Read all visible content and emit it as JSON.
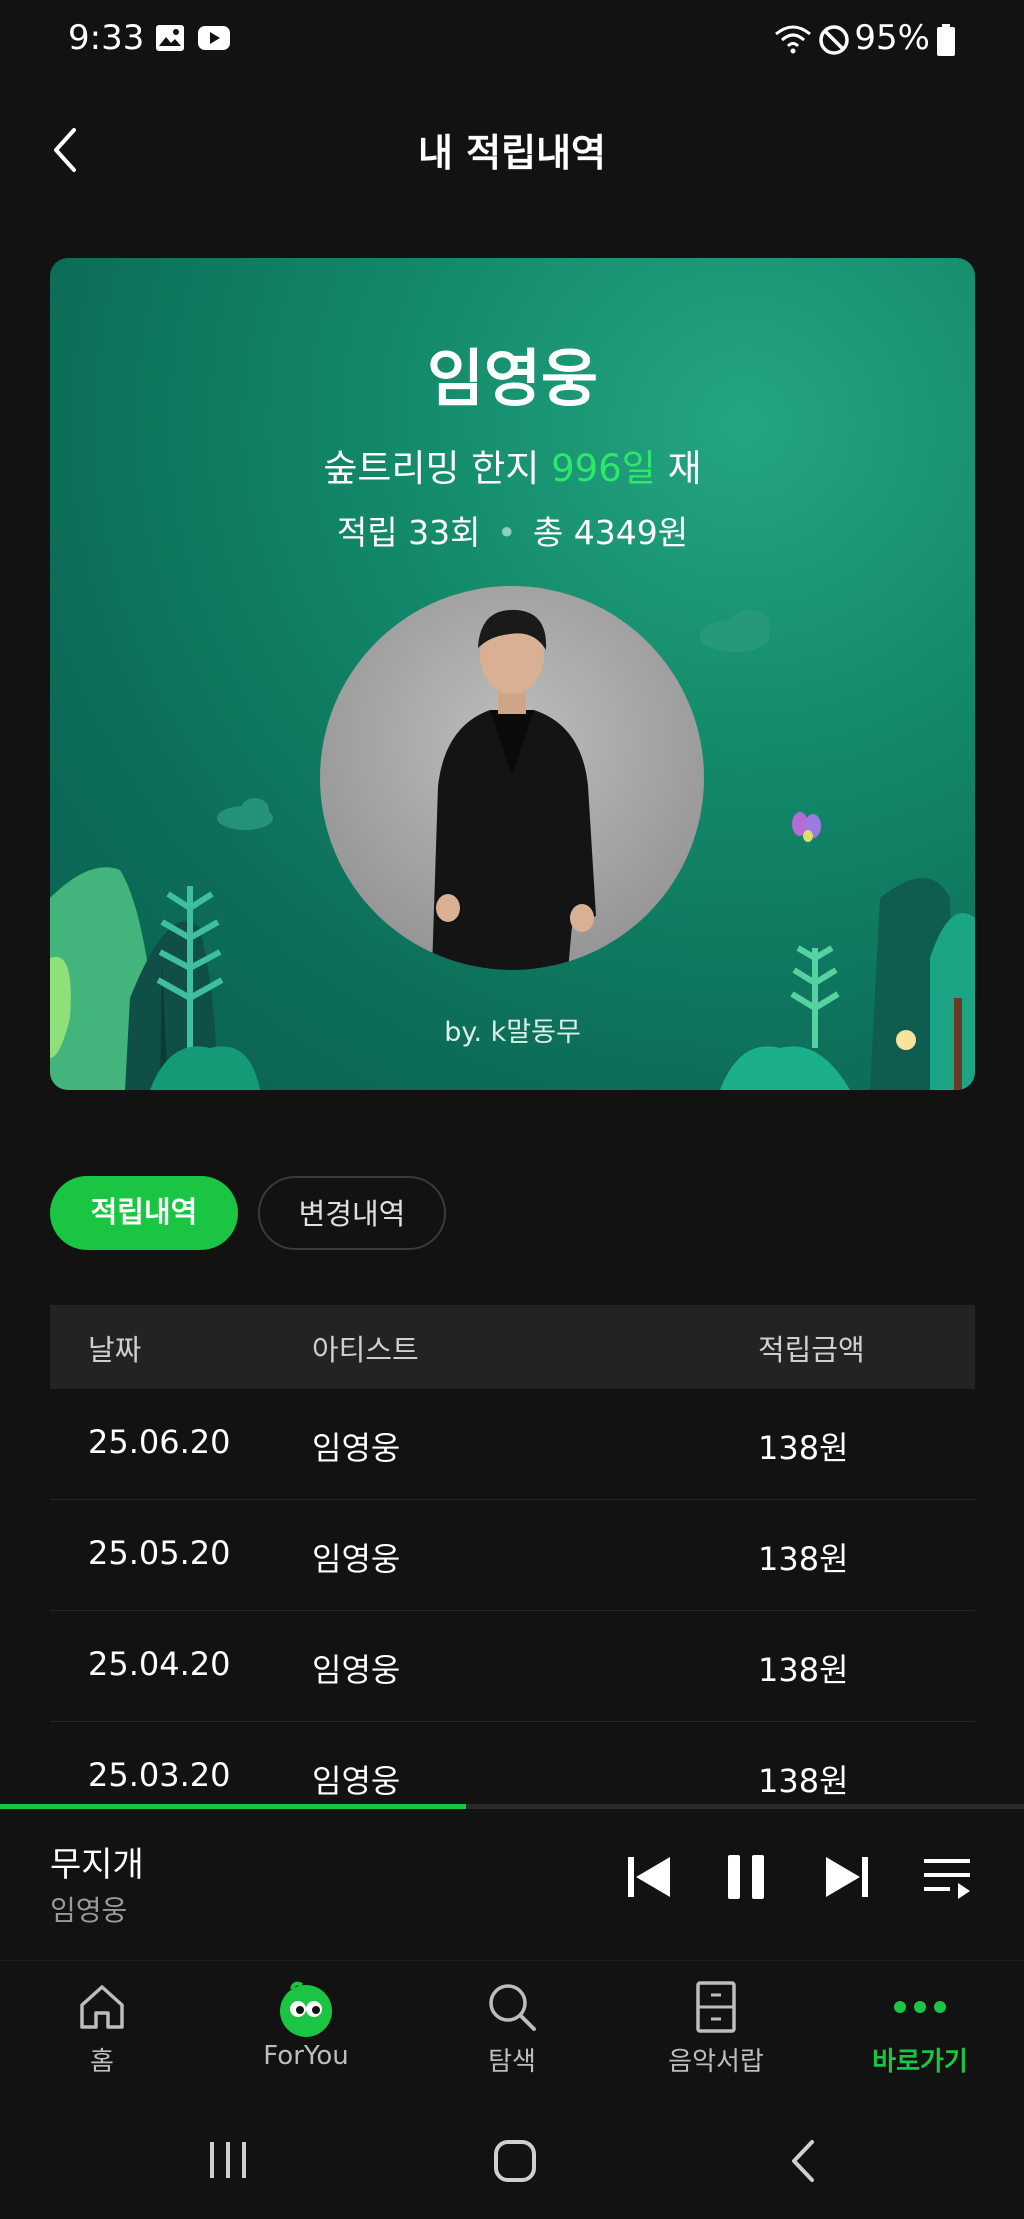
{
  "status_bar": {
    "time": "9:33",
    "battery": "95%"
  },
  "header": {
    "title": "내 적립내역"
  },
  "card": {
    "artist": "임영웅",
    "streak_prefix": "숲트리밍 한지 ",
    "streak_days": "996일",
    "streak_suffix": " 재",
    "count_text": "적립 33회",
    "total_text": "총 4349원",
    "by_text": "by. k말동무"
  },
  "tabs": [
    {
      "label": "적립내역",
      "active": true
    },
    {
      "label": "변경내역",
      "active": false
    }
  ],
  "table": {
    "headers": [
      "날짜",
      "아티스트",
      "적립금액"
    ],
    "rows": [
      [
        "25.06.20",
        "임영웅",
        "138원"
      ],
      [
        "25.05.20",
        "임영웅",
        "138원"
      ],
      [
        "25.04.20",
        "임영웅",
        "138원"
      ],
      [
        "25.03.20",
        "임영웅",
        "138원"
      ]
    ]
  },
  "player": {
    "title": "무지개",
    "artist": "임영웅",
    "progress": 0.455
  },
  "nav": [
    {
      "label": "홈",
      "icon": "home-icon",
      "active": false
    },
    {
      "label": "ForYou",
      "icon": "foryou-mascot-icon",
      "active": false
    },
    {
      "label": "탐색",
      "icon": "search-icon",
      "active": false
    },
    {
      "label": "음악서랍",
      "icon": "drawer-icon",
      "active": false
    },
    {
      "label": "바로가기",
      "icon": "more-dots-icon",
      "active": true
    }
  ],
  "colors": {
    "accent": "#19c542",
    "background": "#121212",
    "card": "#138a6a"
  }
}
